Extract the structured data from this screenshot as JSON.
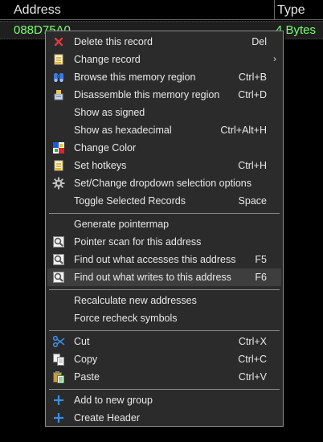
{
  "table": {
    "columns": {
      "address": "Address",
      "type": "Type"
    },
    "row": {
      "address": "088D75A0",
      "type": "4 Bytes"
    }
  },
  "menu": {
    "items": [
      {
        "label": "Delete this record",
        "shortcut": "Del",
        "icon": "delete-x-icon"
      },
      {
        "label": "Change record",
        "shortcut": "",
        "icon": "edit-note-icon",
        "submenu": true
      },
      {
        "label": "Browse this memory region",
        "shortcut": "Ctrl+B",
        "icon": "binoculars-icon"
      },
      {
        "label": "Disassemble this memory region",
        "shortcut": "Ctrl+D",
        "icon": "disassemble-icon"
      },
      {
        "label": "Show as signed",
        "shortcut": ""
      },
      {
        "label": "Show as hexadecimal",
        "shortcut": "Ctrl+Alt+H"
      },
      {
        "label": "Change Color",
        "shortcut": "",
        "icon": "color-palette-icon"
      },
      {
        "label": "Set hotkeys",
        "shortcut": "Ctrl+H",
        "icon": "hotkey-note-icon"
      },
      {
        "label": "Set/Change dropdown selection options",
        "shortcut": "",
        "icon": "gear-icon"
      },
      {
        "label": "Toggle Selected Records",
        "shortcut": "Space"
      },
      {
        "label": "Generate pointermap",
        "shortcut": ""
      },
      {
        "label": "Pointer scan for this address",
        "shortcut": "",
        "icon": "scan-magnifier-icon"
      },
      {
        "label": "Find out what accesses this address",
        "shortcut": "F5",
        "icon": "scan-magnifier-icon"
      },
      {
        "label": "Find out what writes to this address",
        "shortcut": "F6",
        "icon": "scan-magnifier-icon"
      },
      {
        "label": "Recalculate new addresses",
        "shortcut": ""
      },
      {
        "label": "Force recheck symbols",
        "shortcut": ""
      },
      {
        "label": "Cut",
        "shortcut": "Ctrl+X",
        "icon": "scissors-icon"
      },
      {
        "label": "Copy",
        "shortcut": "Ctrl+C",
        "icon": "copy-icon"
      },
      {
        "label": "Paste",
        "shortcut": "Ctrl+V",
        "icon": "paste-icon"
      },
      {
        "label": "Add to new group",
        "shortcut": "",
        "icon": "plus-icon"
      },
      {
        "label": "Create Header",
        "shortcut": "",
        "icon": "plus-icon"
      }
    ]
  },
  "colors": {
    "value_text": "#79ff70",
    "menu_bg": "#2b2b2b",
    "hover_bg": "#3e3e3e",
    "plus_blue": "#3b8de0"
  }
}
